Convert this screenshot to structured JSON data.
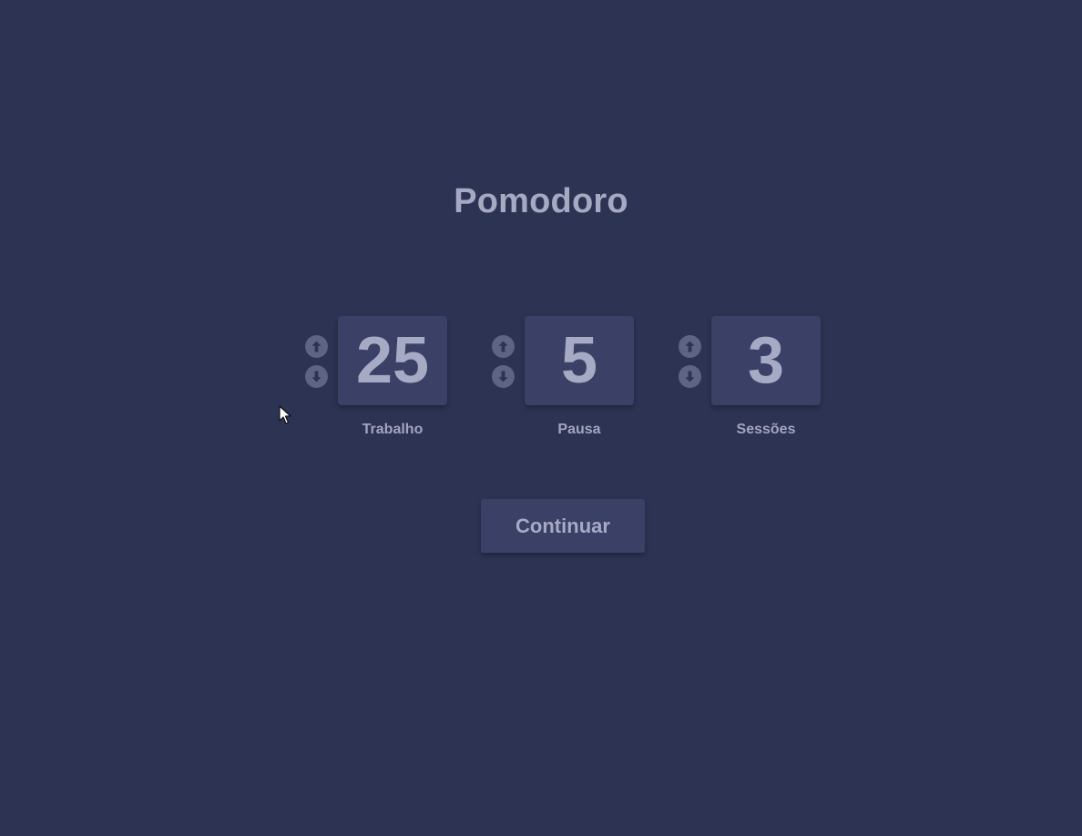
{
  "app": {
    "title": "Pomodoro"
  },
  "counters": [
    {
      "value": "25",
      "label": "Trabalho",
      "up_icon": "arrow-up-circle-icon",
      "down_icon": "arrow-down-circle-icon"
    },
    {
      "value": "5",
      "label": "Pausa",
      "up_icon": "arrow-up-circle-icon",
      "down_icon": "arrow-down-circle-icon"
    },
    {
      "value": "3",
      "label": "Sessões",
      "up_icon": "arrow-up-circle-icon",
      "down_icon": "arrow-down-circle-icon"
    }
  ],
  "actions": {
    "continue_label": "Continuar"
  },
  "colors": {
    "background": "#2d3353",
    "card": "#3a4066",
    "text": "#a7aac4",
    "arrow_button": "#5e6484"
  }
}
